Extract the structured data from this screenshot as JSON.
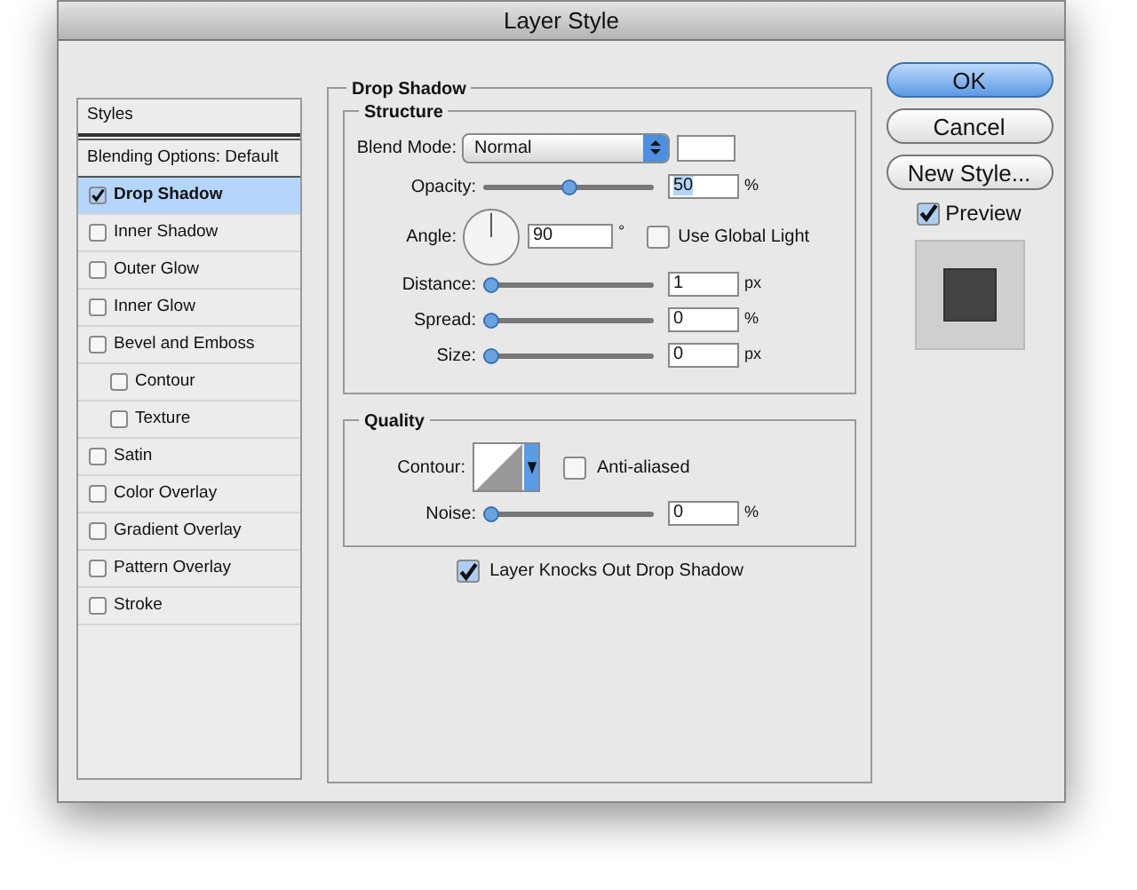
{
  "window": {
    "title": "Layer Style"
  },
  "styles_panel": {
    "header": "Styles",
    "blending_options": "Blending Options: Default",
    "items": [
      {
        "label": "Drop Shadow",
        "checked": true,
        "selected": true
      },
      {
        "label": "Inner Shadow",
        "checked": false,
        "selected": false
      },
      {
        "label": "Outer Glow",
        "checked": false,
        "selected": false
      },
      {
        "label": "Inner Glow",
        "checked": false,
        "selected": false
      },
      {
        "label": "Bevel and Emboss",
        "checked": false,
        "selected": false,
        "children": [
          {
            "label": "Contour",
            "checked": false,
            "selected": false
          },
          {
            "label": "Texture",
            "checked": false,
            "selected": false
          }
        ]
      },
      {
        "label": "Satin",
        "checked": false,
        "selected": false
      },
      {
        "label": "Color Overlay",
        "checked": false,
        "selected": false
      },
      {
        "label": "Gradient Overlay",
        "checked": false,
        "selected": false
      },
      {
        "label": "Pattern Overlay",
        "checked": false,
        "selected": false
      },
      {
        "label": "Stroke",
        "checked": false,
        "selected": false
      }
    ]
  },
  "drop_shadow": {
    "title": "Drop Shadow",
    "structure": {
      "title": "Structure",
      "blend_mode": {
        "label": "Blend Mode:",
        "value": "Normal"
      },
      "opacity": {
        "label": "Opacity:",
        "level": 0.5,
        "value": "50",
        "unit": "%"
      },
      "angle": {
        "label": "Angle:",
        "value": "90",
        "unit": "°",
        "use_global_light": {
          "label": "Use Global Light",
          "checked": false
        }
      },
      "sliders": [
        {
          "label": "Distance:",
          "level": 0,
          "value": "1",
          "unit": "px"
        },
        {
          "label": "Spread:",
          "level": 0,
          "value": "0",
          "unit": "%"
        },
        {
          "label": "Size:",
          "level": 0,
          "value": "0",
          "unit": "px"
        }
      ]
    },
    "quality": {
      "title": "Quality",
      "contour_label": "Contour:",
      "anti_aliased": {
        "label": "Anti-aliased",
        "checked": false
      },
      "noise": {
        "label": "Noise:",
        "level": 0,
        "value": "0",
        "unit": "%"
      }
    },
    "knockout": {
      "label": "Layer Knocks Out Drop Shadow",
      "checked": true
    }
  },
  "buttons": [
    {
      "label": "OK",
      "kind": "default"
    },
    {
      "label": "Cancel",
      "kind": "normal"
    },
    {
      "label": "New Style...",
      "kind": "normal"
    }
  ],
  "preview": {
    "label": "Preview",
    "checked": true
  }
}
